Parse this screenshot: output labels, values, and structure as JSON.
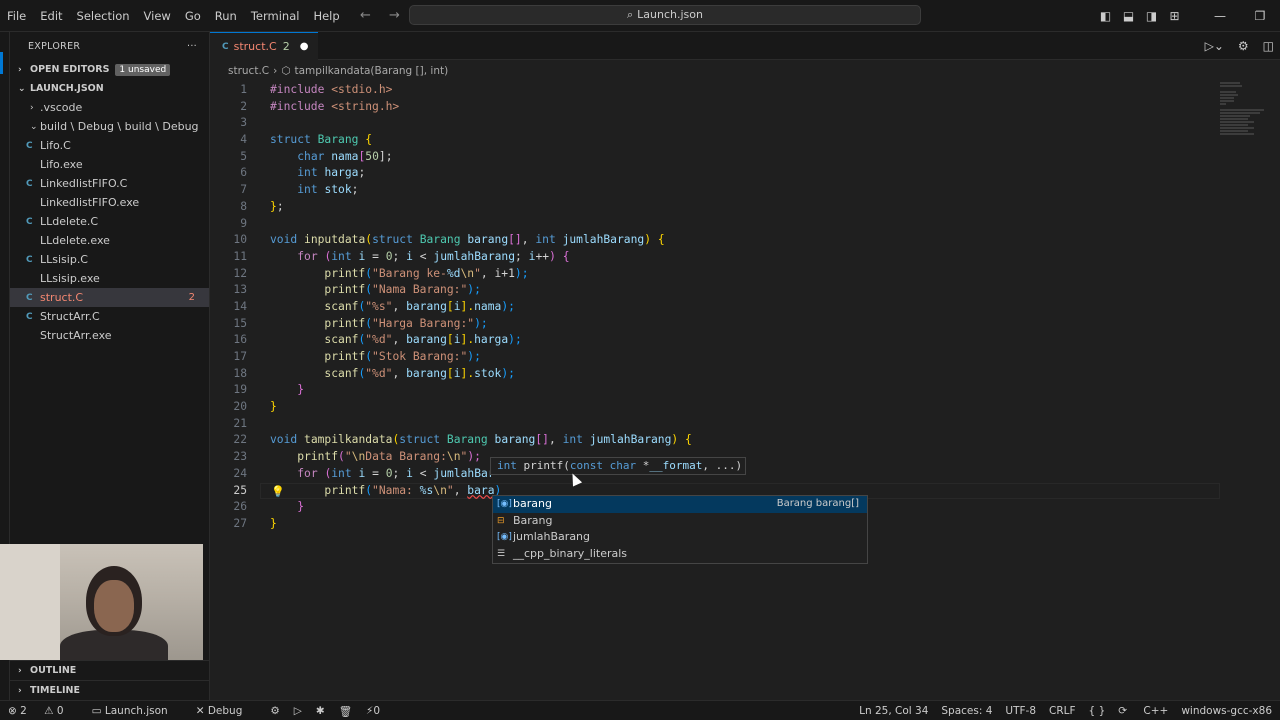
{
  "menu": [
    "File",
    "Edit",
    "Selection",
    "View",
    "Go",
    "Run",
    "Terminal",
    "Help"
  ],
  "search": {
    "text": "Launch.json"
  },
  "sidebar": {
    "title": "EXPLORER",
    "open_editors": "OPEN EDITORS",
    "unsaved_badge": "1 unsaved",
    "folder": "LAUNCH.JSON",
    "items": [
      {
        "label": ".vscode",
        "type": "folder"
      },
      {
        "label": "build \\ Debug \\ build \\ Debug",
        "type": "folder"
      },
      {
        "label": "Lifo.C",
        "type": "c"
      },
      {
        "label": "Lifo.exe",
        "type": "exe"
      },
      {
        "label": "LinkedlistFIFO.C",
        "type": "c"
      },
      {
        "label": "LinkedlistFIFO.exe",
        "type": "exe"
      },
      {
        "label": "LLdelete.C",
        "type": "c"
      },
      {
        "label": "LLdelete.exe",
        "type": "exe"
      },
      {
        "label": "LLsisip.C",
        "type": "c"
      },
      {
        "label": "LLsisip.exe",
        "type": "exe"
      },
      {
        "label": "struct.C",
        "type": "c",
        "selected": true,
        "problems": "2"
      },
      {
        "label": "StructArr.C",
        "type": "c"
      },
      {
        "label": "StructArr.exe",
        "type": "exe"
      }
    ],
    "outline": "OUTLINE",
    "timeline": "TIMELINE"
  },
  "tab": {
    "label": "struct.C",
    "problems": "2"
  },
  "breadcrumb": {
    "file": "struct.C",
    "symbol": "tampilkandata(Barang [], int)"
  },
  "code": {
    "l1": [
      "#include",
      " <stdio.h>"
    ],
    "l2": [
      "#include",
      " <string.h>"
    ],
    "l4": [
      "struct",
      "Barang",
      "{"
    ],
    "l5": [
      "char",
      "nama",
      "[",
      "50",
      "];"
    ],
    "l6": [
      "int",
      "harga",
      ";"
    ],
    "l7": [
      "int",
      "stok",
      ";"
    ],
    "l8": [
      "}",
      ";"
    ],
    "l10": [
      "void",
      "inputdata",
      "(",
      "struct",
      "Barang",
      "barang",
      "[]",
      ",",
      "int",
      "jumlahBarang",
      ")",
      "{"
    ],
    "l11": [
      "for",
      "(",
      "int",
      "i",
      "=",
      "0",
      ";",
      "i",
      "<",
      "jumlahBarang",
      ";",
      "i",
      "++",
      ")",
      "{"
    ],
    "l12": [
      "printf",
      "(",
      "\"Barang ke-",
      "%d",
      "\\n",
      "\"",
      ", i+1",
      ");"
    ],
    "l13": [
      "printf",
      "(",
      "\"Nama Barang:\"",
      ");"
    ],
    "l14": [
      "scanf",
      "(",
      "\"%s\"",
      ", ",
      "barang",
      "[",
      "i",
      "].",
      "nama",
      ");"
    ],
    "l15": [
      "printf",
      "(",
      "\"Harga Barang:\"",
      ");"
    ],
    "l16": [
      "scanf",
      "(",
      "\"%d\"",
      ", ",
      "barang",
      "[",
      "i",
      "].",
      "harga",
      ");"
    ],
    "l17": [
      "printf",
      "(",
      "\"Stok Barang:\"",
      ");"
    ],
    "l18": [
      "scanf",
      "(",
      "\"%d\"",
      ", ",
      "barang",
      "[",
      "i",
      "].",
      "stok",
      ");"
    ],
    "l19": [
      "}"
    ],
    "l20": [
      "}"
    ],
    "l22": [
      "void",
      "tampilkandata",
      "(",
      "struct",
      "Barang",
      "barang",
      "[]",
      ",",
      "int",
      "jumlahBarang",
      ")",
      "{"
    ],
    "l23": [
      "printf",
      "(",
      "\"",
      "\\n",
      "Data Barang:",
      "\\n",
      "\"",
      ");"
    ],
    "l24": [
      "for",
      "(",
      "int",
      "i",
      "=",
      "0",
      ";",
      "i",
      "<",
      "jumlahBar"
    ],
    "l25": [
      "printf",
      "(",
      "\"Nama: ",
      "%s",
      "\\n",
      "\"",
      ", ",
      "bara",
      ")"
    ],
    "l26": [
      "}"
    ],
    "l27": [
      "}"
    ]
  },
  "hover": {
    "ret": "int",
    "fn": "printf",
    "open": "(",
    "k1": "const",
    "k2": "char",
    "star": " *",
    "param": "__format",
    "rest": ", ...)"
  },
  "suggest": [
    {
      "label": "barang",
      "detail": "Barang barang[]",
      "kind": "var"
    },
    {
      "label": "Barang",
      "detail": "",
      "kind": "struct"
    },
    {
      "label": "jumlahBarang",
      "detail": "",
      "kind": "var"
    },
    {
      "label": "__cpp_binary_literals",
      "detail": "",
      "kind": "plain"
    }
  ],
  "status": {
    "errors": "2",
    "warnings": "0",
    "launch": "Launch.json",
    "debug": "Debug",
    "ports": "0",
    "position": "Ln 25, Col 34",
    "spaces": "Spaces: 4",
    "encoding": "UTF-8",
    "eol": "CRLF",
    "lang_braces": "{ }",
    "language": "C++",
    "config": "windows-gcc-x86"
  },
  "colors": {
    "accent": "#0078d4",
    "error": "#f48771",
    "bulb": "#ffcc00"
  }
}
